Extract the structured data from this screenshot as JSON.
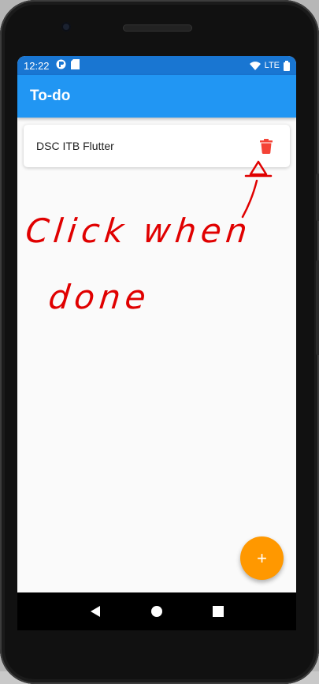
{
  "status_bar": {
    "time": "12:22",
    "network_label": "LTE",
    "bg_color": "#1976d2"
  },
  "app_bar": {
    "title": "To-do",
    "bg_color": "#2196f3"
  },
  "tasks": [
    {
      "text": "DSC ITB Flutter",
      "action_icon": "delete-icon",
      "action_color": "#f44336"
    }
  ],
  "annotation": {
    "handwritten_text": [
      "Click when",
      "done"
    ],
    "ink_color": "#e00000"
  },
  "fab": {
    "label": "+",
    "color": "#ff9800"
  },
  "nav_bar": {
    "icons": [
      "back-icon",
      "home-icon",
      "recents-icon"
    ]
  }
}
